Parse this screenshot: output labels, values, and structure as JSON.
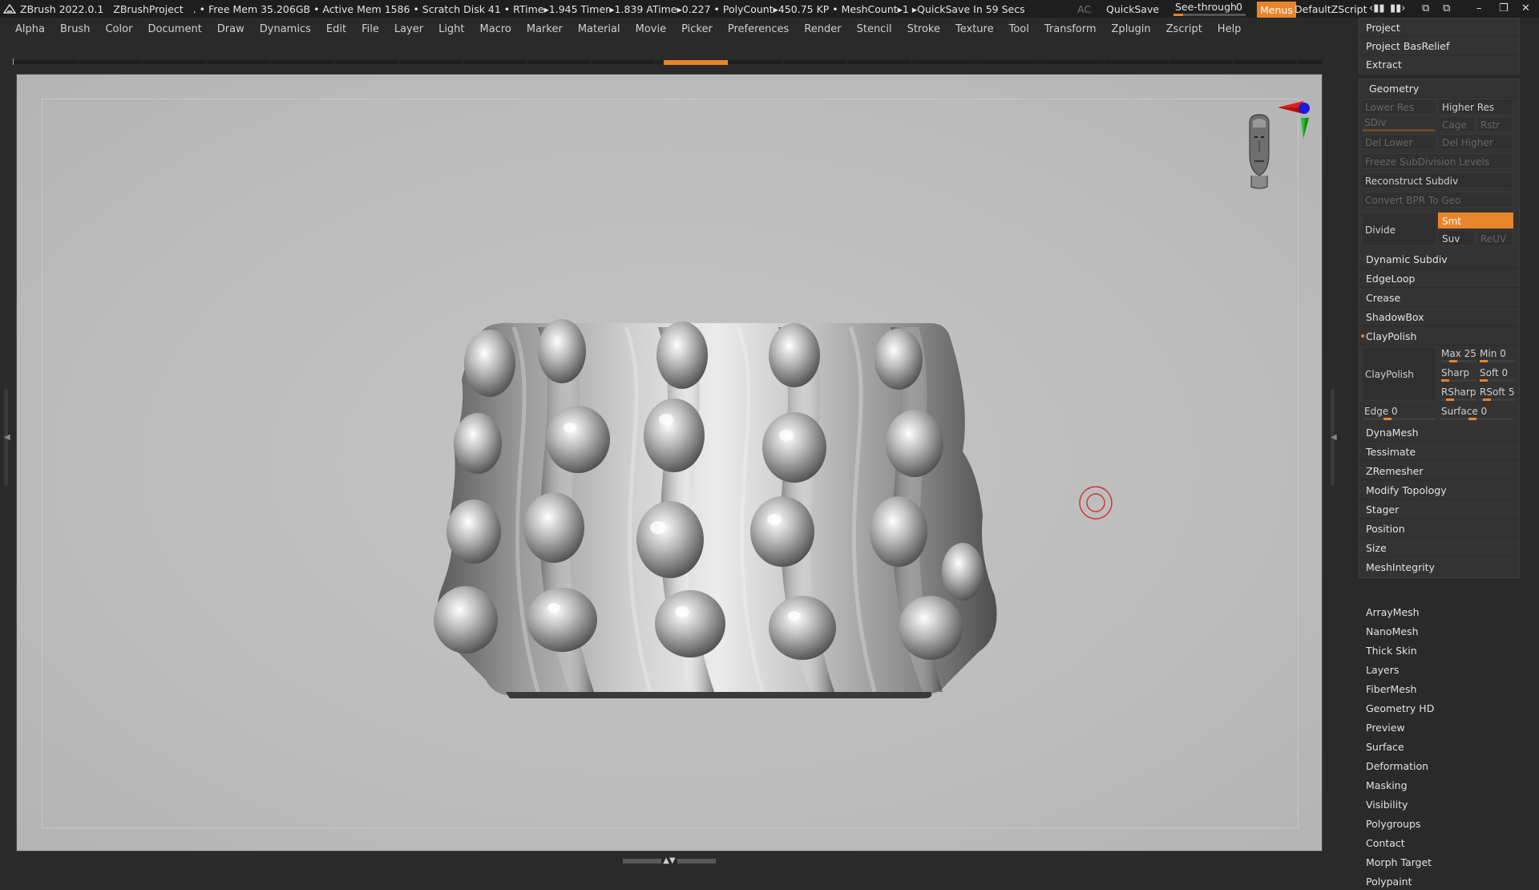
{
  "titlebar": {
    "app": "ZBrush 2022.0.1",
    "project": "ZBrushProject",
    "stats": ". • Free Mem 35.206GB • Active Mem 1586 • Scratch Disk 41 •  RTime▸1.945 Timer▸1.839 ATime▸0.227 • PolyCount▸450.75 KP  • MeshCount▸1  ▸QuickSave In 59 Secs",
    "ac": "AC",
    "quicksave": "QuickSave",
    "seethrough_label": "See-through",
    "seethrough_value": "0",
    "seethrough_level": 0.0,
    "menus": "Menus",
    "default_zscript": "DefaultZScript"
  },
  "menubar": {
    "items": [
      "Alpha",
      "Brush",
      "Color",
      "Document",
      "Draw",
      "Dynamics",
      "Edit",
      "File",
      "Layer",
      "Light",
      "Macro",
      "Marker",
      "Material",
      "Movie",
      "Picker",
      "Preferences",
      "Render",
      "Stencil",
      "Stroke",
      "Texture",
      "Tool",
      "Transform",
      "Zplugin",
      "Zscript",
      "Help"
    ]
  },
  "colors": {
    "accent": "#e8852a",
    "panel_bg": "#2a2a2a",
    "viewport_bg": "#bdbdbd"
  },
  "panel": {
    "top_items": [
      "Project",
      "Project BasRelief",
      "Extract"
    ],
    "geometry": {
      "title": "Geometry",
      "lower_res": "Lower Res",
      "higher_res": "Higher Res",
      "sdiv": "SDiv",
      "cage": "Cage",
      "rstr": "Rstr",
      "del_lower": "Del Lower",
      "del_higher": "Del Higher",
      "freeze": "Freeze SubDivision Levels",
      "reconstruct": "Reconstruct Subdiv",
      "convert_bpr": "Convert BPR To Geo",
      "divide": "Divide",
      "smt": "Smt",
      "suv": "Suv",
      "reuv": "ReUV",
      "dynamic_subdiv": "Dynamic Subdiv",
      "edgeloop": "EdgeLoop",
      "crease": "Crease",
      "shadowbox": "ShadowBox",
      "claypolish_header": "ClayPolish",
      "claypolish_btn": "ClayPolish",
      "max": "Max 25",
      "min": "Min 0",
      "sharp": "Sharp",
      "soft": "Soft 0",
      "rsharp": "RSharp",
      "rsoft": "RSoft 5",
      "edge": "Edge 0",
      "surface": "Surface 0",
      "dynamesh": "DynaMesh",
      "tessimate": "Tessimate",
      "zremesher": "ZRemesher",
      "modify_topology": "Modify Topology",
      "stager": "Stager",
      "position": "Position",
      "size": "Size",
      "meshintegrity": "MeshIntegrity"
    },
    "subpalettes": [
      "ArrayMesh",
      "NanoMesh",
      "Thick Skin",
      "Layers",
      "FiberMesh",
      "Geometry HD",
      "Preview",
      "Surface",
      "Deformation",
      "Masking",
      "Visibility",
      "Polygroups",
      "Contact",
      "Morph Target",
      "Polypaint"
    ]
  },
  "icons": {
    "logo": "zbrush-logo-icon",
    "gizmo": "navigation-head-gizmo-icon",
    "cursor": "brush-cursor-ring-icon"
  }
}
